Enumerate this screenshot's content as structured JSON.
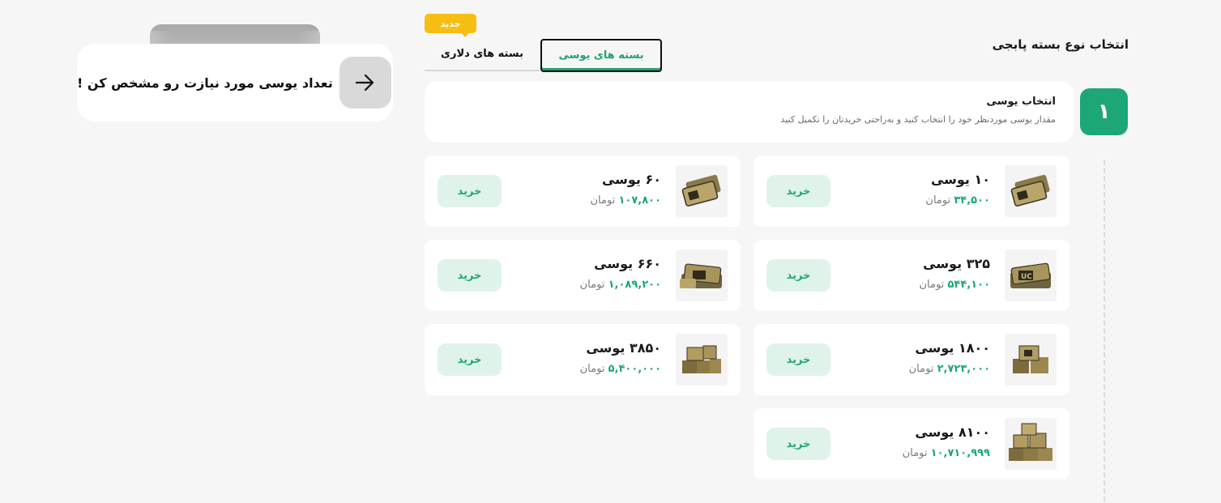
{
  "hint": {
    "text": "تعداد یوسی مورد نیازت رو مشخص کن !",
    "arrow_icon": "arrow-right-icon"
  },
  "header": {
    "title": "انتخاب نوع بسته پابجی",
    "tabs": [
      {
        "label": "بسته های یوسی",
        "active": true
      },
      {
        "label": "بسته های دلاری",
        "active": false
      }
    ],
    "new_badge": "جدید"
  },
  "step": {
    "number": "۱",
    "title": "انتخاب یوسی",
    "description": "مقدار یوسی موردنظر خود را انتخاب کنید و به‌راحتی خریدتان را تکمیل کنید"
  },
  "packages": [
    {
      "amount": "۱۰ یوسی",
      "price": "۳۴,۵۰۰",
      "currency": "تومان",
      "buy_label": "خرید",
      "icon": "uc-cards-icon"
    },
    {
      "amount": "۶۰ یوسی",
      "price": "۱۰۷,۸۰۰",
      "currency": "تومان",
      "buy_label": "خرید",
      "icon": "uc-cards-icon"
    },
    {
      "amount": "۳۲۵ یوسی",
      "price": "۵۴۴,۱۰۰",
      "currency": "تومان",
      "buy_label": "خرید",
      "icon": "uc-stack-icon"
    },
    {
      "amount": "۶۶۰ یوسی",
      "price": "۱,۰۸۹,۲۰۰",
      "currency": "تومان",
      "buy_label": "خرید",
      "icon": "uc-stack-icon"
    },
    {
      "amount": "۱۸۰۰ یوسی",
      "price": "۲,۷۲۳,۰۰۰",
      "currency": "تومان",
      "buy_label": "خرید",
      "icon": "uc-crates-icon"
    },
    {
      "amount": "۳۸۵۰ یوسی",
      "price": "۵,۴۰۰,۰۰۰",
      "currency": "تومان",
      "buy_label": "خرید",
      "icon": "uc-crates-icon"
    },
    {
      "amount": "۸۱۰۰ یوسی",
      "price": "۱۰,۷۱۰,۹۹۹",
      "currency": "تومان",
      "buy_label": "خرید",
      "icon": "uc-pile-icon"
    }
  ],
  "colors": {
    "accent": "#1ea776",
    "badge": "#f6be12",
    "buy_bg": "#dff3ea"
  }
}
